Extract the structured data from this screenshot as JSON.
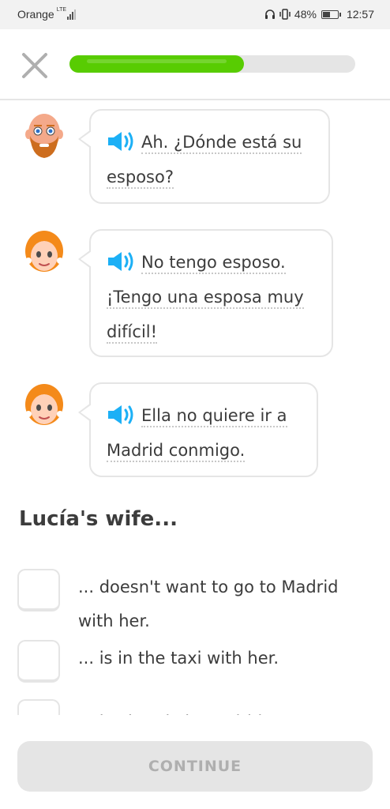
{
  "status_bar": {
    "carrier": "Orange",
    "network": "LTE",
    "battery_percent": "48%",
    "time": "12:57",
    "icons": [
      "headphones-icon",
      "vibrate-icon",
      "battery-icon"
    ]
  },
  "header": {
    "close_icon": "close-icon",
    "progress": 0.61,
    "colors": {
      "progress_fill": "#58cc02",
      "progress_track": "#e5e5e5"
    }
  },
  "conversation": [
    {
      "speaker": "bald-bearded-man",
      "lines": [
        "Ah. ¿Dónde está su",
        "esposo?"
      ],
      "audio_icon": "speaker-icon"
    },
    {
      "speaker": "orange-haired-woman",
      "lines": [
        "No tengo esposo.",
        "¡Tengo una esposa muy",
        "difícil!"
      ],
      "audio_icon": "speaker-icon"
    },
    {
      "speaker": "orange-haired-woman",
      "lines": [
        "Ella no quiere ir a",
        "Madrid conmigo."
      ],
      "audio_icon": "speaker-icon"
    }
  ],
  "question": "Lucía's wife...",
  "options": [
    {
      "lines": [
        "... doesn't want to go to Madrid",
        "with her."
      ],
      "checked": false
    },
    {
      "lines": [
        "... is in the taxi with her."
      ],
      "checked": false
    },
    {
      "lines": [
        "... is already in Madrid."
      ],
      "checked": false
    }
  ],
  "continue_label": "CONTINUE",
  "colors": {
    "accent_blue": "#1cb0f6",
    "continue_disabled_bg": "#e5e5e5",
    "continue_disabled_text": "#afafaf"
  }
}
